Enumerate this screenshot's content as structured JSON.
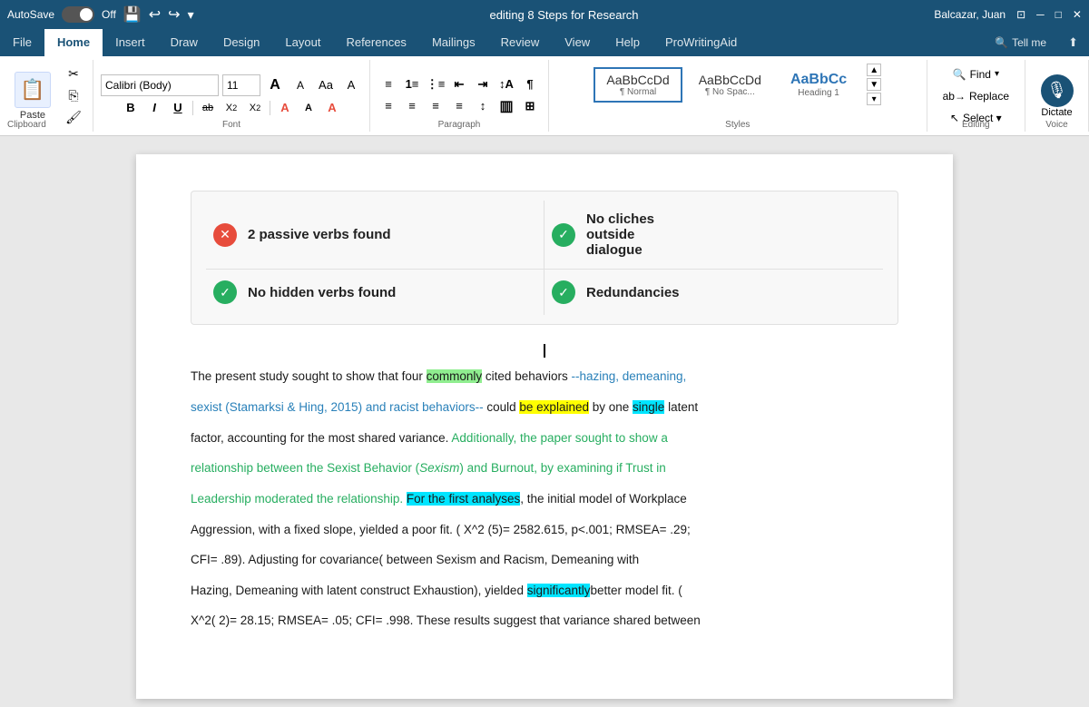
{
  "titlebar": {
    "autosave_label": "AutoSave",
    "autosave_state": "Off",
    "title": "editing 8 Steps for Research",
    "user": "Balcazar, Juan",
    "buttons": {
      "minimize": "─",
      "restore": "□",
      "close": "✕"
    }
  },
  "ribbon": {
    "tabs": [
      "File",
      "Home",
      "Insert",
      "Draw",
      "Design",
      "Layout",
      "References",
      "Mailings",
      "Review",
      "View",
      "Help",
      "ProWritingAid"
    ],
    "active_tab": "Home",
    "tell_me": "Tell me",
    "clipboard": {
      "paste_label": "Paste"
    },
    "font": {
      "name": "Calibri (Body)",
      "size": "11",
      "grow": "A",
      "shrink": "A",
      "case": "Aa",
      "clear": "A"
    },
    "format": {
      "bold": "B",
      "italic": "I",
      "underline": "U",
      "strikethrough": "ab",
      "sub": "X₂",
      "sup": "X²"
    },
    "styles": [
      {
        "id": "normal",
        "preview": "AaBbCcDd",
        "label": "¶ Normal",
        "active": true
      },
      {
        "id": "no-space",
        "preview": "AaBbCcDd",
        "label": "¶ No Spac..."
      },
      {
        "id": "heading1",
        "preview": "AaBbCc",
        "label": "Heading 1"
      }
    ],
    "editing": {
      "find_label": "Find",
      "replace_label": "Replace",
      "select_label": "Select ▾"
    },
    "voice": {
      "dictate_label": "Dictate"
    }
  },
  "panel": {
    "items": [
      {
        "type": "pair",
        "left": {
          "status": "error",
          "text": "2 passive verbs found"
        },
        "right": {
          "status": "success",
          "text_line1": "No cliches",
          "text_line2": "outside",
          "text_line3": "dialogue"
        }
      },
      {
        "type": "pair",
        "left": {
          "status": "success",
          "text": "No hidden verbs found"
        },
        "right": {
          "status": "success",
          "text": "Redundancies"
        }
      }
    ]
  },
  "document": {
    "paragraphs": [
      {
        "id": "p1",
        "segments": [
          {
            "text": "The present study sought to show that four ",
            "style": "normal"
          },
          {
            "text": "commonly",
            "style": "highlight-green"
          },
          {
            "text": " cited behaviors ",
            "style": "normal"
          },
          {
            "text": "--hazing, demeaning,",
            "style": "text-blue-link"
          }
        ]
      },
      {
        "id": "p2",
        "segments": [
          {
            "text": "sexist (Stamarksi & Hing, 2015) and racist behaviors--",
            "style": "text-blue-link"
          },
          {
            "text": " could ",
            "style": "normal"
          },
          {
            "text": "be explained",
            "style": "highlight-yellow"
          },
          {
            "text": " by one ",
            "style": "normal"
          },
          {
            "text": "single",
            "style": "highlight-cyan"
          },
          {
            "text": " latent",
            "style": "normal"
          }
        ]
      },
      {
        "id": "p3",
        "segments": [
          {
            "text": "factor, accounting for the most shared variance. ",
            "style": "normal"
          },
          {
            "text": "Additionally, the paper sought to show a",
            "style": "text-green"
          }
        ]
      },
      {
        "id": "p4",
        "segments": [
          {
            "text": "relationship between the Sexist Behavior (",
            "style": "text-green"
          },
          {
            "text": "Sexism",
            "style": "text-green italic"
          },
          {
            "text": ") and Burnout, by examining if Trust in",
            "style": "text-green"
          }
        ]
      },
      {
        "id": "p5",
        "segments": [
          {
            "text": "Leadership moderated the relationship. ",
            "style": "text-green"
          },
          {
            "text": "For the first analyses",
            "style": "highlight-cyan"
          },
          {
            "text": ", the initial model of Workplace",
            "style": "normal"
          }
        ]
      },
      {
        "id": "p6",
        "segments": [
          {
            "text": "Aggression, with a fixed slope, yielded a poor fit. ( X^2 (5)= 2582.615, p<.001; RMSEA= .29;",
            "style": "normal"
          }
        ]
      },
      {
        "id": "p7",
        "segments": [
          {
            "text": "CFI= .89). Adjusting for covariance( between Sexism and Racism, Demeaning with",
            "style": "normal"
          }
        ]
      },
      {
        "id": "p8",
        "segments": [
          {
            "text": "Hazing,  Demeaning with latent construct Exhaustion), yielded ",
            "style": "normal"
          },
          {
            "text": "significantly",
            "style": "highlight-cyan"
          },
          {
            "text": "better model fit. (",
            "style": "normal"
          }
        ]
      },
      {
        "id": "p9",
        "segments": [
          {
            "text": "X^2( 2)= 28.15; RMSEA= .05; CFI= .998. These results suggest that variance shared between",
            "style": "normal"
          }
        ]
      }
    ]
  }
}
